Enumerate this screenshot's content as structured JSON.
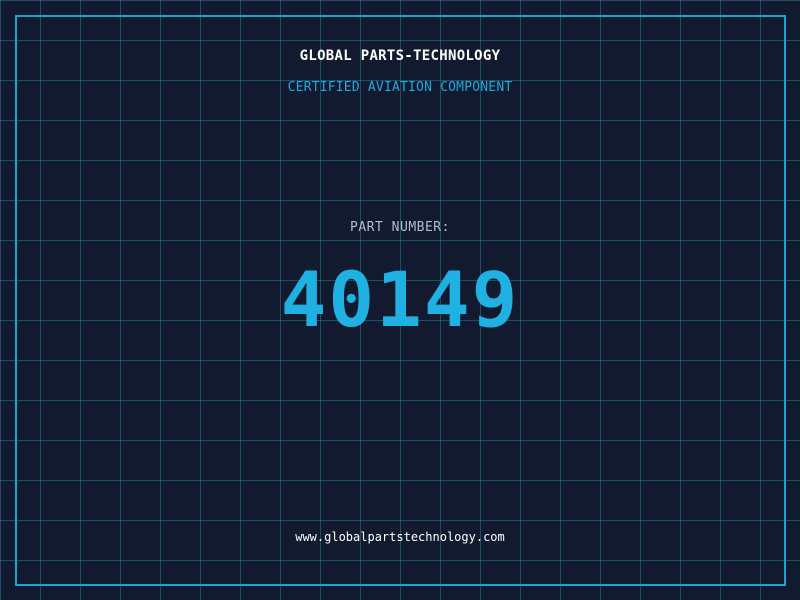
{
  "label": {
    "company_name": "GLOBAL PARTS-TECHNOLOGY",
    "subtitle": "CERTIFIED AVIATION COMPONENT",
    "part_number_label": "PART NUMBER:",
    "part_number": "40149",
    "website": "www.globalpartstechnology.com"
  },
  "colors": {
    "background": "#111a2f",
    "grid": "#28789a",
    "frame": "#1fa3cf",
    "accent": "#1fb1e2",
    "primary_text": "#ffffff",
    "muted_text": "#b4bccb"
  }
}
